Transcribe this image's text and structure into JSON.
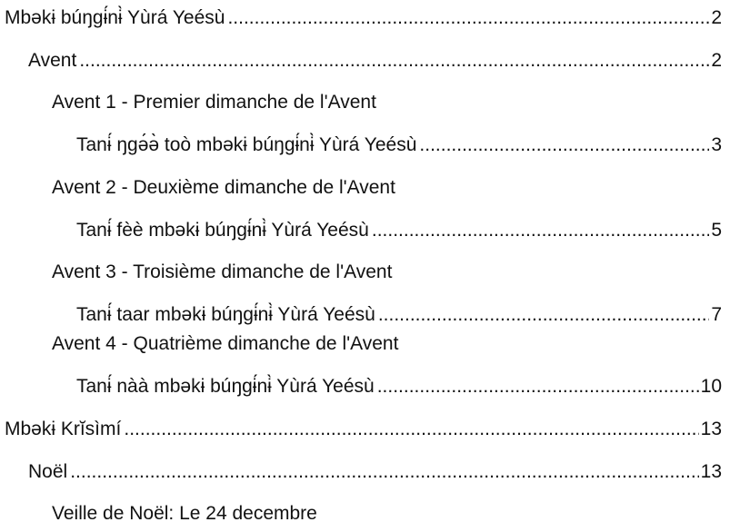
{
  "toc": {
    "entries": [
      {
        "level": 1,
        "text": "Mbəkɨ búŋgɨ́nɨ̀ Yùrá Yeésù",
        "page": "2"
      },
      {
        "level": 2,
        "text": "Avent",
        "page": "2"
      },
      {
        "level": 3,
        "text": "Avent 1 - Premier dimanche de l'Avent",
        "page": ""
      },
      {
        "level": 4,
        "text": "Tanɨ́ ŋgə́ə̀ toò mbəkɨ búŋgɨ́nɨ̀ Yùrá Yeésù",
        "page": "3"
      },
      {
        "level": 3,
        "text": "Avent 2 - Deuxième dimanche de l'Avent",
        "page": ""
      },
      {
        "level": 4,
        "text": "Tanɨ́ fèè mbəkɨ búŋgɨ́nɨ̀ Yùrá Yeésù",
        "page": "5"
      },
      {
        "level": 3,
        "text": "Avent 3 - Troisième dimanche de l'Avent",
        "page": ""
      },
      {
        "level": 4,
        "text": "Tanɨ́ taar mbəkɨ búŋgɨ́nɨ̀ Yùrá Yeésù",
        "page": "7"
      },
      {
        "level": 3,
        "text": "Avent 4 - Quatrième dimanche de l'Avent",
        "page": ""
      },
      {
        "level": 4,
        "text": "Tanɨ́ nàà mbəkɨ búŋgɨ́nɨ̀ Yùrá Yeésù",
        "page": "10"
      },
      {
        "level": 1,
        "text": "Mbəkɨ Krĭsìmí",
        "page": "13"
      },
      {
        "level": 2,
        "text": "Noël",
        "page": "13"
      },
      {
        "level": 3,
        "text": "Veille de Noël: Le 24 decembre",
        "page": ""
      }
    ]
  }
}
